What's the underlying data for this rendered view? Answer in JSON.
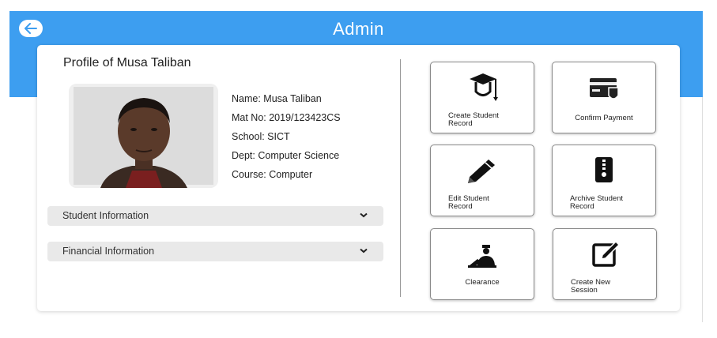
{
  "header": {
    "title": "Admin",
    "back_icon": "arrow-left-icon",
    "color": "#3d9ef0"
  },
  "profile": {
    "title": "Profile of Musa Taliban",
    "name": "Name: Musa Taliban",
    "mat_no": "Mat No: 2019/123423CS",
    "school": "School: SICT",
    "dept": "Dept: Computer Science",
    "course": "Course: Computer"
  },
  "sections": [
    {
      "label": "Student Information",
      "icon": "chevron-down-icon"
    },
    {
      "label": "Financial Information",
      "icon": "chevron-down-icon"
    }
  ],
  "actions": [
    {
      "label_line1": "Create Student",
      "label_line2": "Record",
      "icon": "graduation-cap-icon"
    },
    {
      "label_line1": "Confirm Payment",
      "label_line2": "",
      "icon": "payment-card-shield-icon"
    },
    {
      "label_line1": "Edit Student",
      "label_line2": "Record",
      "icon": "pencil-icon"
    },
    {
      "label_line1": "Archive Student",
      "label_line2": "Record",
      "icon": "archive-zip-icon"
    },
    {
      "label_line1": "Clearance",
      "label_line2": "",
      "icon": "clearance-officer-icon"
    },
    {
      "label_line1": "Create New",
      "label_line2": "Session",
      "icon": "new-session-edit-icon"
    }
  ]
}
